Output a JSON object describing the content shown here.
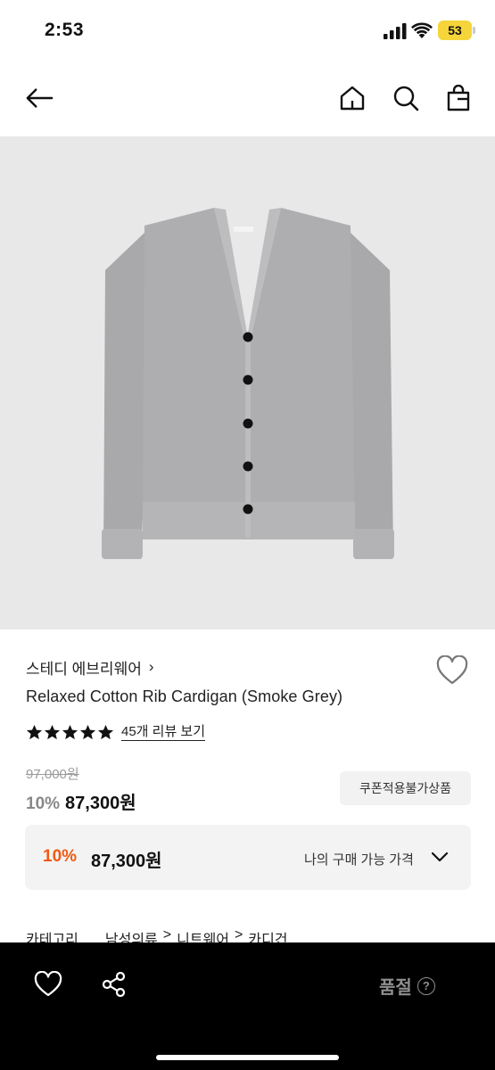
{
  "status_bar": {
    "time": "2:53",
    "battery_level": "53",
    "battery_color": "#f5d53a"
  },
  "nav": {
    "back_icon": "arrow-left-icon",
    "home_icon": "home-icon",
    "search_icon": "search-icon",
    "cart_icon": "shopping-bag-icon"
  },
  "product": {
    "image_icon": "cardigan-image",
    "image_background": "#e8e8e8",
    "brand": "스테디 에브리웨어",
    "brand_chevron": "›",
    "name": "Relaxed Cotton Rib Cardigan (Smoke Grey)",
    "rating_stars": 5,
    "review_link": "45개 리뷰 보기",
    "original_price": "97,000원",
    "discount": "10%",
    "sale_price": "87,300원",
    "coupon_badge": "쿠폰적용불가상품"
  },
  "my_price": {
    "discount": "10%",
    "price": "87,300원",
    "label": "나의 구매 가능 가격",
    "accent_color": "#f05a14"
  },
  "category": {
    "items": [
      "카테고리",
      "남성의류",
      "니트웨어",
      "카디건"
    ],
    "separator": ">"
  },
  "bottom_bar": {
    "like_icon": "heart-icon",
    "share_icon": "share-icon",
    "status_label": "품절",
    "help_glyph": "?"
  }
}
